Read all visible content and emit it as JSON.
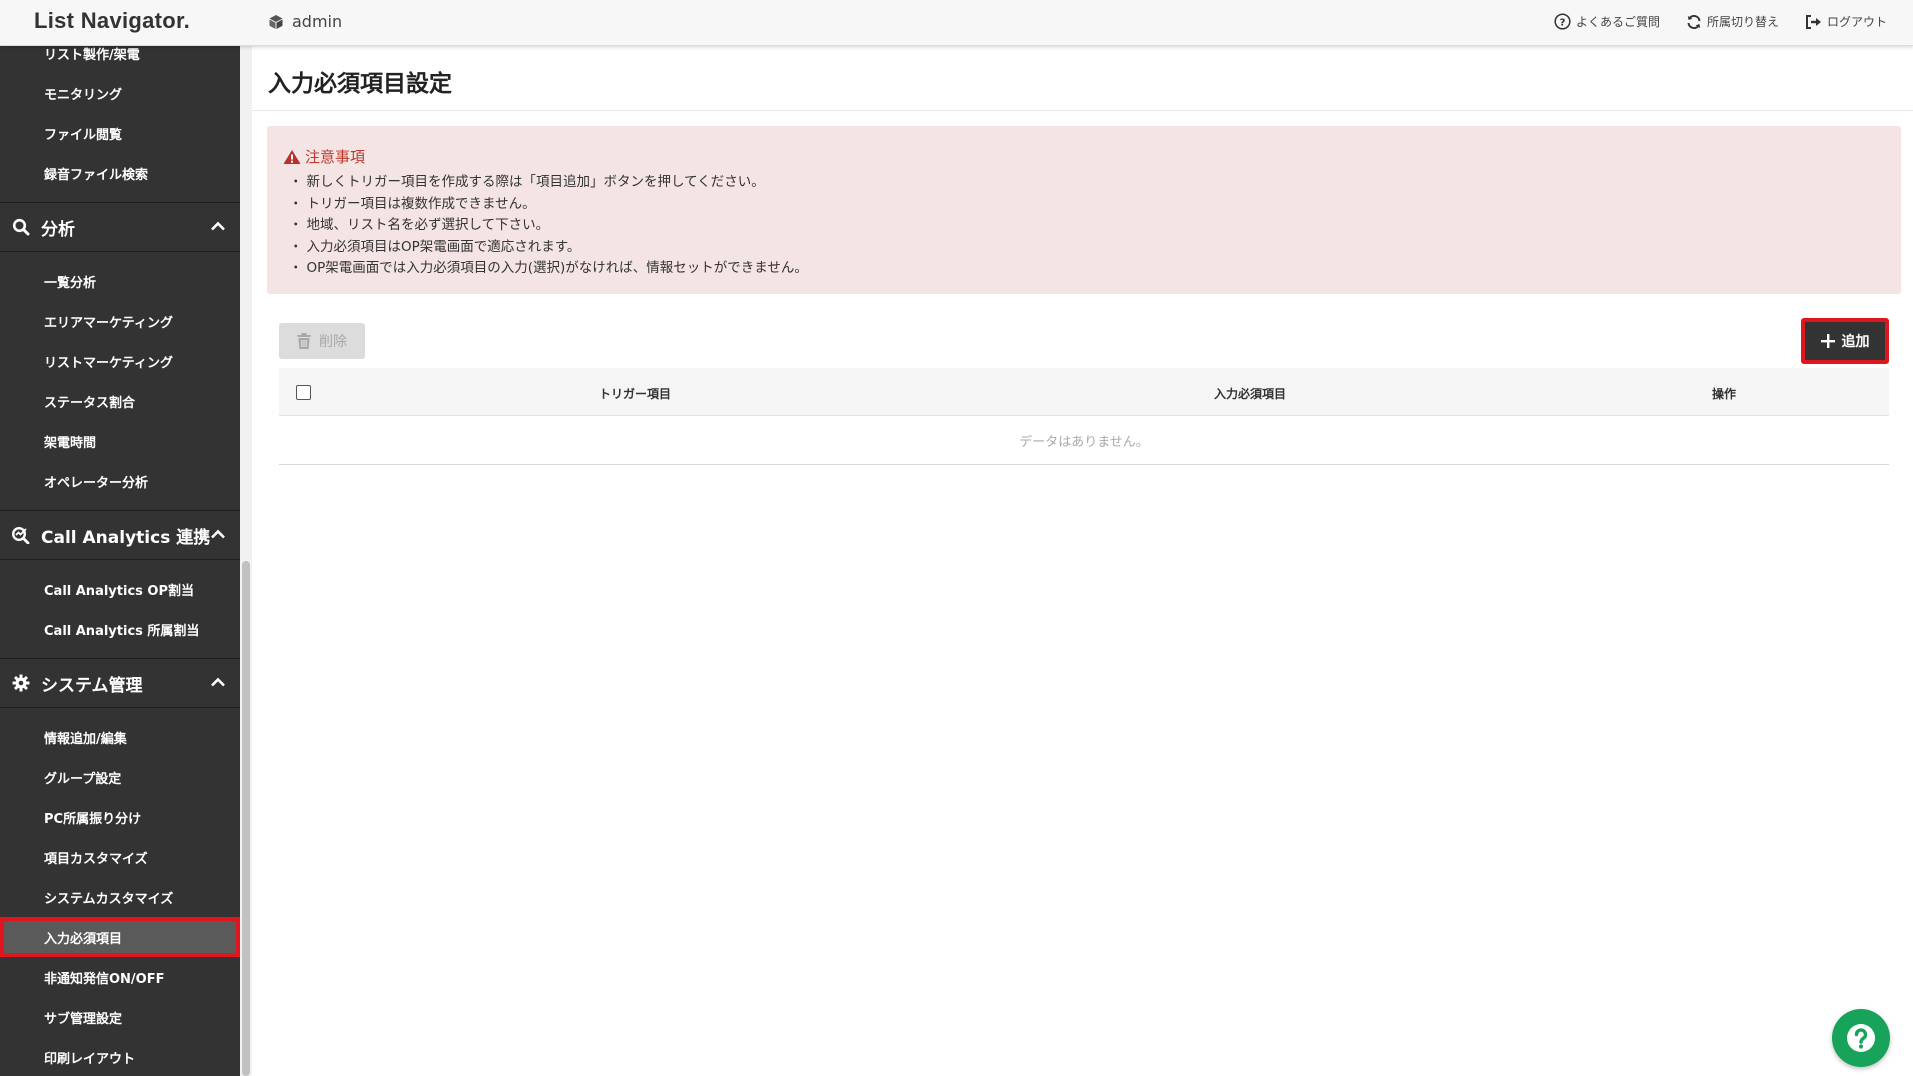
{
  "header": {
    "logo": "List Navigator.",
    "user": "admin",
    "faq": "よくあるご質問",
    "switch_affiliation": "所属切り替え",
    "logout": "ログアウト"
  },
  "sidebar": {
    "items_top": [
      "リスト製作/架電",
      "モニタリング",
      "ファイル閲覧",
      "録音ファイル検索"
    ],
    "groups": [
      {
        "title": "分析",
        "icon": "search-icon",
        "items": [
          "一覧分析",
          "エリアマーケティング",
          "リストマーケティング",
          "ステータス割合",
          "架電時間",
          "オペレーター分析"
        ]
      },
      {
        "title": "Call Analytics 連携",
        "icon": "analytics-icon",
        "items": [
          "Call Analytics OP割当",
          "Call Analytics 所属割当"
        ]
      },
      {
        "title": "システム管理",
        "icon": "gear-icon",
        "items": [
          "情報追加/編集",
          "グループ設定",
          "PC所属振り分け",
          "項目カスタマイズ",
          "システムカスタマイズ",
          "入力必須項目",
          "非通知発信ON/OFF",
          "サブ管理設定",
          "印刷レイアウト"
        ]
      }
    ],
    "active_item": "入力必須項目"
  },
  "main": {
    "title": "入力必須項目設定",
    "notice": {
      "title": "注意事項",
      "items": [
        "新しくトリガー項目を作成する際は「項目追加」ボタンを押してください。",
        "トリガー項目は複数作成できません。",
        "地域、リスト名を必ず選択して下さい。",
        "入力必須項目はOP架電画面で適応されます。",
        "OP架電画面では入力必須項目の入力(選択)がなければ、情報セットができません。"
      ]
    },
    "delete_label": "削除",
    "add_label": "追加",
    "table": {
      "columns": [
        "トリガー項目",
        "入力必須項目",
        "操作"
      ],
      "empty_text": "データはありません。"
    }
  },
  "colors": {
    "sidebar_bg": "#333333",
    "highlight_red": "#e0161f",
    "notice_bg": "#f4e4e4",
    "notice_title": "#c0392b",
    "fab_green": "#17a35a"
  }
}
